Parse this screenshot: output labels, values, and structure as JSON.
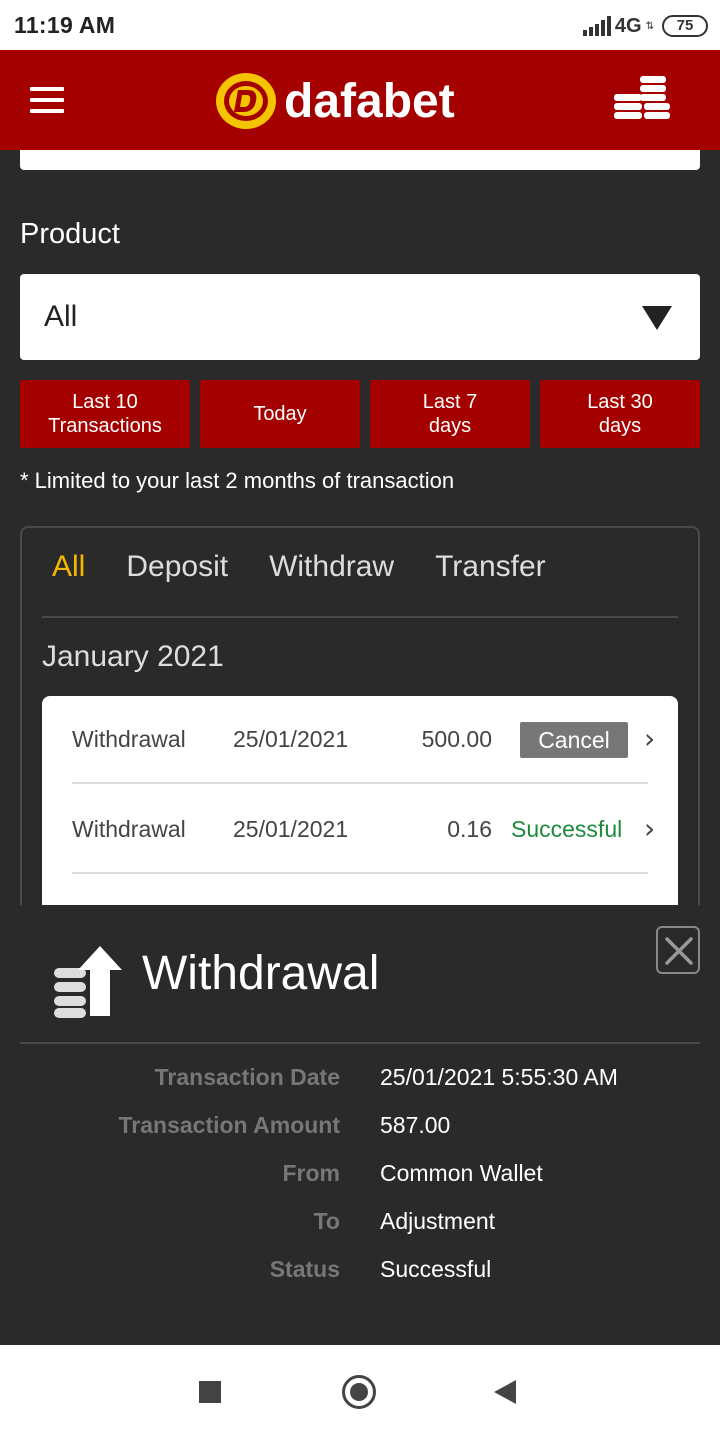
{
  "status_bar": {
    "time": "11:19 AM",
    "network": "4G",
    "battery": "75"
  },
  "header": {
    "brand": "dafabet"
  },
  "filters": {
    "product_label": "Product",
    "product_value": "All",
    "quick_buttons": [
      "Last 10\nTransactions",
      "Today",
      "Last 7\ndays",
      "Last 30\ndays"
    ],
    "note": "* Limited to your last 2 months of transaction"
  },
  "tabs": [
    "All",
    "Deposit",
    "Withdraw",
    "Transfer"
  ],
  "active_tab": "All",
  "month_heading": "January 2021",
  "transactions": [
    {
      "type": "Withdrawal",
      "date": "25/01/2021",
      "amount": "500.00",
      "action": "Cancel"
    },
    {
      "type": "Withdrawal",
      "date": "25/01/2021",
      "amount": "0.16",
      "status": "Successful"
    }
  ],
  "detail": {
    "title": "Withdrawal",
    "fields": [
      {
        "label": "Transaction Date",
        "value": "25/01/2021 5:55:30 AM"
      },
      {
        "label": "Transaction Amount",
        "value": "587.00"
      },
      {
        "label": "From",
        "value": "Common Wallet"
      },
      {
        "label": "To",
        "value": "Adjustment"
      },
      {
        "label": "Status",
        "value": "Successful"
      }
    ]
  },
  "colors": {
    "brand_red": "#a40000",
    "accent_yellow": "#f5b800",
    "success_green": "#1e8a3c"
  }
}
